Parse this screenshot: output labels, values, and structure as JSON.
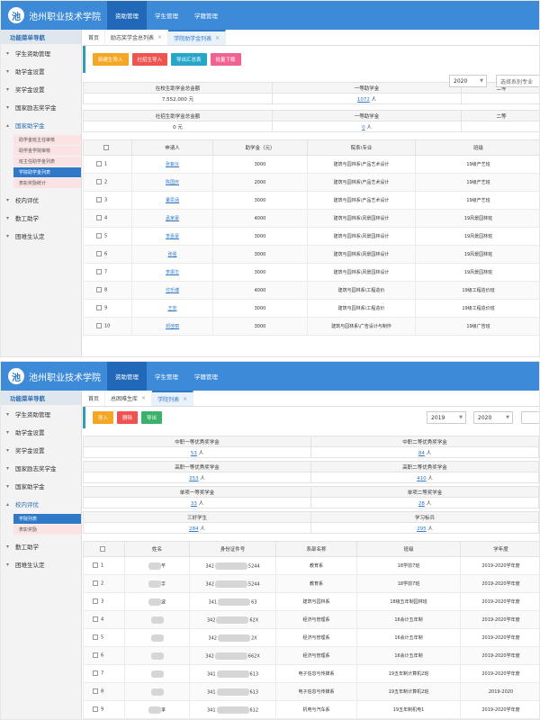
{
  "shot1": {
    "header": {
      "logo_mark": "池",
      "title": "池州职业技术学院",
      "modules": [
        "资助管理",
        "学生管理",
        "学籍管理"
      ]
    },
    "sidebar": {
      "title": "功能菜单导航",
      "items": [
        "学生资助管理",
        "助学金设置",
        "奖学金设置",
        "国家励志奖学金",
        "国家助学金",
        "校内评优",
        "勤工助学",
        "困难生认定"
      ],
      "sub_items": [
        "助学金班主任审核",
        "助学金学院审核",
        "班主任助学金列表",
        "学院助学金列表",
        "表彰奖励统计"
      ]
    },
    "tabs": [
      "首页",
      "励志奖学金总列表",
      "学院助学金列表"
    ],
    "toolbar": {
      "buttons": [
        "新建生导入",
        "社招生导入",
        "导出汇总表",
        "批量下载"
      ],
      "year": "2020",
      "select_placeholder": "选择系别专业"
    },
    "stats": {
      "h1": "在校生助学金总金额",
      "v1": "7,552,000 元",
      "h2": "一等助学金",
      "v2": "1072",
      "v2_unit": "人",
      "h3": "二等",
      "h4": "社招生助学金总金额",
      "v4": "0 元",
      "h5": "一等助学金",
      "v5": "0",
      "v5_unit": "人",
      "h6": "二等"
    },
    "table": {
      "headers": [
        "",
        "申请人",
        "助学金（元）",
        "院系\\专业",
        "班级"
      ],
      "rows": [
        {
          "no": "1",
          "name": "张紫仪",
          "amount": "3000",
          "dept": "建筑与园林系\\产品艺术设计",
          "class": "19级产艺班"
        },
        {
          "no": "2",
          "name": "陈国庆",
          "amount": "2000",
          "dept": "建筑与园林系\\产品艺术设计",
          "class": "19级产艺班"
        },
        {
          "no": "3",
          "name": "董思涵",
          "amount": "3000",
          "dept": "建筑与园林系\\产品艺术设计",
          "class": "19级产艺班"
        },
        {
          "no": "4",
          "name": "孟家豪",
          "amount": "4000",
          "dept": "建筑与园林系\\风景园林设计",
          "class": "19风景园林班"
        },
        {
          "no": "5",
          "name": "李嘉豪",
          "amount": "3000",
          "dept": "建筑与园林系\\风景园林设计",
          "class": "19风景园林班"
        },
        {
          "no": "6",
          "name": "张强",
          "amount": "3000",
          "dept": "建筑与园林系\\风景园林设计",
          "class": "19风景园林班"
        },
        {
          "no": "7",
          "name": "李振华",
          "amount": "3000",
          "dept": "建筑与园林系\\风景园林设计",
          "class": "19风景园林班"
        },
        {
          "no": "8",
          "name": "付乐博",
          "amount": "4000",
          "dept": "建筑与园林系\\工程造价",
          "class": "19级工程造价班"
        },
        {
          "no": "9",
          "name": "王宏",
          "amount": "3000",
          "dept": "建筑与园林系\\工程造价",
          "class": "19级工程造价班"
        },
        {
          "no": "10",
          "name": "邓佳丽",
          "amount": "3000",
          "dept": "建筑与园林系\\广告设计与制作",
          "class": "19级广告班"
        }
      ]
    }
  },
  "shot2": {
    "header": {
      "logo_mark": "池",
      "title": "池州职业技术学院",
      "modules": [
        "资助管理",
        "学生管理",
        "学籍管理"
      ]
    },
    "sidebar": {
      "title": "功能菜单导航",
      "items": [
        "学生资助管理",
        "助学金设置",
        "奖学金设置",
        "国家励志奖学金",
        "国家助学金",
        "校内评优",
        "勤工助学",
        "困难生认定"
      ],
      "sub_items": [
        "学院列表",
        "表彰奖励"
      ]
    },
    "tabs": [
      "首页",
      "总困难生库",
      "学院列表"
    ],
    "toolbar": {
      "buttons": [
        "导入",
        "删除",
        "导出"
      ],
      "year_from": "2019",
      "year_to": "2020"
    },
    "stats": {
      "h1": "中职一等优秀奖学金",
      "v1": "53",
      "h2": "中职二等优秀奖学金",
      "v2": "84",
      "h3": "高职一等优秀奖学金",
      "v3": "253",
      "h4": "高职二等优秀奖学金",
      "v4": "410",
      "h5": "单项一等奖学金",
      "v5": "33",
      "h6": "单项二等奖学金",
      "v6": "28",
      "h7": "三好学生",
      "v7": "284",
      "h8": "学习标兵",
      "v8": "295",
      "unit": "人"
    },
    "table": {
      "headers": [
        "",
        "姓名",
        "身份证件号",
        "系部名称",
        "班级",
        "学年度"
      ],
      "rows": [
        {
          "no": "1",
          "name": "芊",
          "id_pre": "342",
          "id_suf": "5244",
          "dept": "教育系",
          "class": "18学前7班",
          "year": "2019-2020学年度"
        },
        {
          "no": "2",
          "name": "字",
          "id_pre": "342",
          "id_suf": "5244",
          "dept": "教育系",
          "class": "18学前7班",
          "year": "2019-2020学年度"
        },
        {
          "no": "3",
          "name": "波",
          "id_pre": "341",
          "id_suf": "63",
          "dept": "建筑与园林系",
          "class": "18级五年制园林班",
          "year": "2019-2020学年度"
        },
        {
          "no": "4",
          "name": "",
          "id_pre": "342",
          "id_suf": "62X",
          "dept": "经济与管理系",
          "class": "16会计五年制",
          "year": "2019-2020学年度"
        },
        {
          "no": "5",
          "name": "",
          "id_pre": "342",
          "id_suf": "2X",
          "dept": "经济与管理系",
          "class": "16会计五年制",
          "year": "2019-2020学年度"
        },
        {
          "no": "6",
          "name": "",
          "id_pre": "342",
          "id_suf": "662X",
          "dept": "经济与管理系",
          "class": "16会计五年制",
          "year": "2019-2020学年度"
        },
        {
          "no": "7",
          "name": "",
          "id_pre": "341",
          "id_suf": "613",
          "dept": "电子信息与传媒系",
          "class": "19五年制计算机2班",
          "year": "2019-2020学年度"
        },
        {
          "no": "8",
          "name": "",
          "id_pre": "341",
          "id_suf": "613",
          "dept": "电子信息与传媒系",
          "class": "19五年制计算机2班",
          "year": "2019-2020"
        },
        {
          "no": "9",
          "name": "李",
          "id_pre": "341",
          "id_suf": "612",
          "dept": "机电与汽车系",
          "class": "19五年制机电1",
          "year": "2019-2020学年度"
        }
      ]
    }
  }
}
